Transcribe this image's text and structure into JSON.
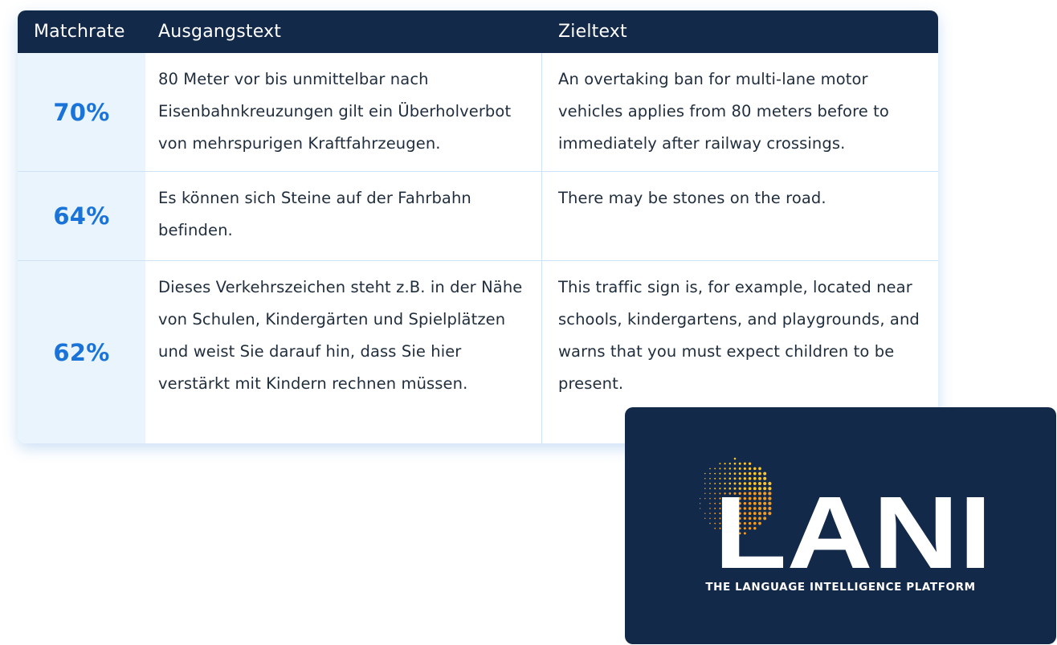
{
  "table": {
    "headers": {
      "matchrate": "Matchrate",
      "source": "Ausgangstext",
      "target": "Zieltext"
    },
    "rows": [
      {
        "matchrate": "70%",
        "source": "80 Meter vor bis unmittelbar nach Eisenbahnkreuzungen gilt ein Überholverbot von mehrspurigen Kraftfahrzeugen.",
        "target": "An overtaking ban for multi-lane motor vehicles applies from 80 meters before to immediately after railway crossings."
      },
      {
        "matchrate": "64%",
        "source": "Es können sich Steine auf der Fahrbahn befinden.",
        "target": "There may be stones on the road."
      },
      {
        "matchrate": "62%",
        "source": "Dieses Verkehrszeichen steht z.B. in der Nähe von Schulen, Kindergärten und Spielplätzen und weist Sie darauf hin, dass Sie hier verstärkt mit Kindern rechnen müssen.",
        "target": "This traffic sign is, for example, located near schools, kindergartens, and playgrounds, and warns that you must expect children to be present."
      }
    ]
  },
  "logo": {
    "wordmark": "LANI",
    "tagline": "THE LANGUAGE INTELLIGENCE PLATFORM",
    "icon": "globe-dots-icon"
  },
  "colors": {
    "header_bg": "#13294a",
    "rate_accent": "#1a73d9",
    "rate_cell_bg": "#eaf4fd",
    "logo_orange": "#f39a1f",
    "logo_yellow": "#ffc629"
  }
}
